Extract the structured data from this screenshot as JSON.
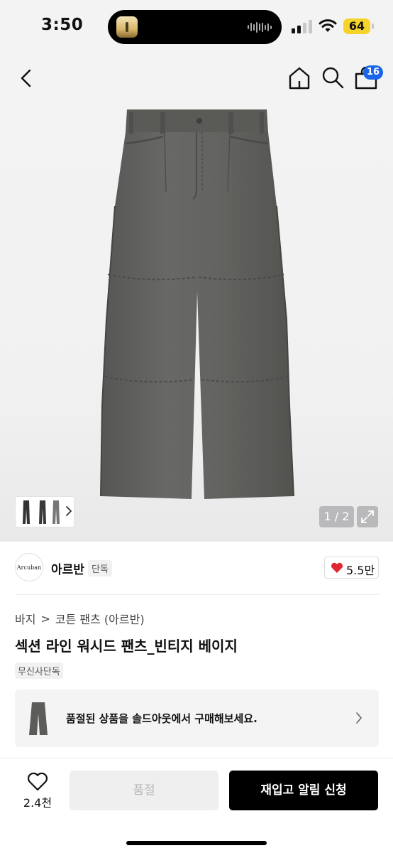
{
  "status_bar": {
    "time": "3:50",
    "battery": "64"
  },
  "nav": {
    "cart_badge": "16"
  },
  "gallery": {
    "page_counter": "1 / 2"
  },
  "brand": {
    "logo_text": "Arcuban",
    "name": "아르반",
    "badge": "단독",
    "likes": "5.5만"
  },
  "product": {
    "breadcrumb": [
      "바지",
      "코튼 팬츠 (아르반)"
    ],
    "breadcrumb_separator": ">",
    "title": "섹션 라인 워시드 팬츠_빈티지 베이지",
    "tag": "무신사단독"
  },
  "soldout_notice": {
    "text": "품절된 상품을 솔드아웃에서 구매해보세요."
  },
  "bottom_bar": {
    "wish_count": "2.4천",
    "soldout_label": "품절",
    "restock_label": "재입고 알림 신청"
  },
  "colors": {
    "accent_blue": "#1a66e8",
    "heart_red": "#e0262f",
    "battery_yellow": "#f5d32a",
    "pants_grey": "#5f5f5d"
  }
}
